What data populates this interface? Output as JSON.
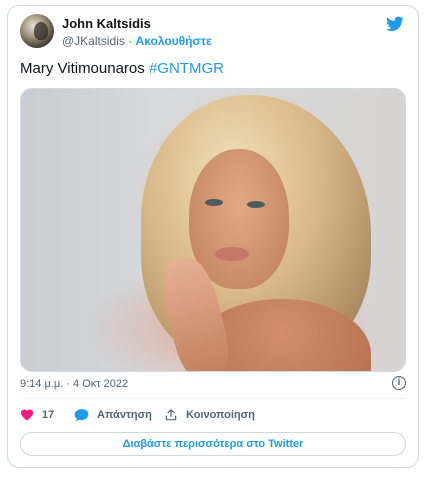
{
  "author": {
    "name": "John Kaltsidis",
    "handle": "@JKaltsidis",
    "separator": " · ",
    "follow_label": "Ακολουθήστε"
  },
  "tweet": {
    "text": "Mary Vitimounaros ",
    "hashtag": "#GNTMGR",
    "timestamp": "9:14 μ.μ. · 4 Οκτ 2022"
  },
  "actions": {
    "likes_count": "17",
    "reply_label": "Απάντηση",
    "share_label": "Κοινοποίηση"
  },
  "read_more_label": "Διαβάστε περισσότερα στο Twitter",
  "icons": {
    "brand": "twitter-bird-icon",
    "info": "info-icon",
    "like": "heart-icon",
    "reply": "speech-bubble-icon",
    "share": "share-icon"
  },
  "colors": {
    "accent": "#1d9bf0",
    "like": "#f91880",
    "muted": "#536471"
  }
}
